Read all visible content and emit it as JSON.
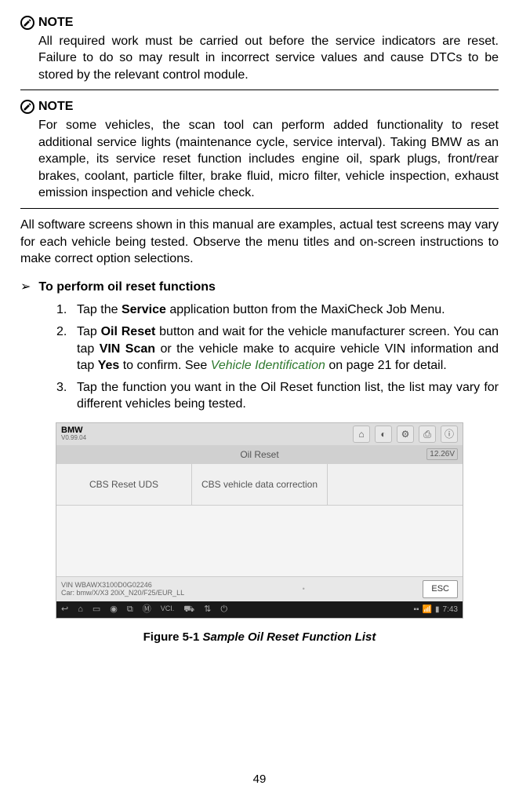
{
  "note1": {
    "label": "NOTE",
    "body": "All required work must be carried out before the service indicators are reset. Failure to do so may result in incorrect service values and cause DTCs to be stored by the relevant control module."
  },
  "note2": {
    "label": "NOTE",
    "body": "For some vehicles, the scan tool can perform added functionality to reset additional service lights (maintenance cycle, service interval). Taking BMW as an example, its service reset function includes engine oil, spark plugs, front/rear brakes, coolant, particle filter, brake fluid, micro filter, vehicle inspection, exhaust emission inspection and vehicle check."
  },
  "para1": "All software screens shown in this manual are examples, actual test screens may vary for each vehicle being tested. Observe the menu titles and on-screen instructions to make correct option selections.",
  "procedure_title": "To perform oil reset functions",
  "steps": {
    "s1": {
      "pre": "Tap the ",
      "b1": "Service",
      "post": " application button from the MaxiCheck Job Menu."
    },
    "s2": {
      "pre": "Tap ",
      "b1": "Oil Reset",
      "mid1": " button and wait for the vehicle manufacturer screen. You can tap ",
      "b2": "VIN Scan",
      "mid2": " or the vehicle make to acquire vehicle VIN information and tap ",
      "b3": "Yes",
      "mid3": " to confirm. See ",
      "link": "Vehicle Identification",
      "post": " on page 21 for detail."
    },
    "s3": "Tap the function you want in the Oil Reset function list, the list may vary for different vehicles being tested."
  },
  "screenshot": {
    "brand": "BMW",
    "version": "V0.99.04",
    "title": "Oil Reset",
    "voltage": "12.26V",
    "func1": "CBS Reset UDS",
    "func2": "CBS vehicle data correction",
    "vin_label": "VIN WBAWX3100D0G02246",
    "car_label": "Car: bmw/X/X3 20iX_N20/F25/EUR_LL",
    "esc": "ESC",
    "time": "7:43"
  },
  "figure": {
    "num": "Figure 5-1",
    "title": " Sample Oil Reset Function List"
  },
  "page": "49"
}
